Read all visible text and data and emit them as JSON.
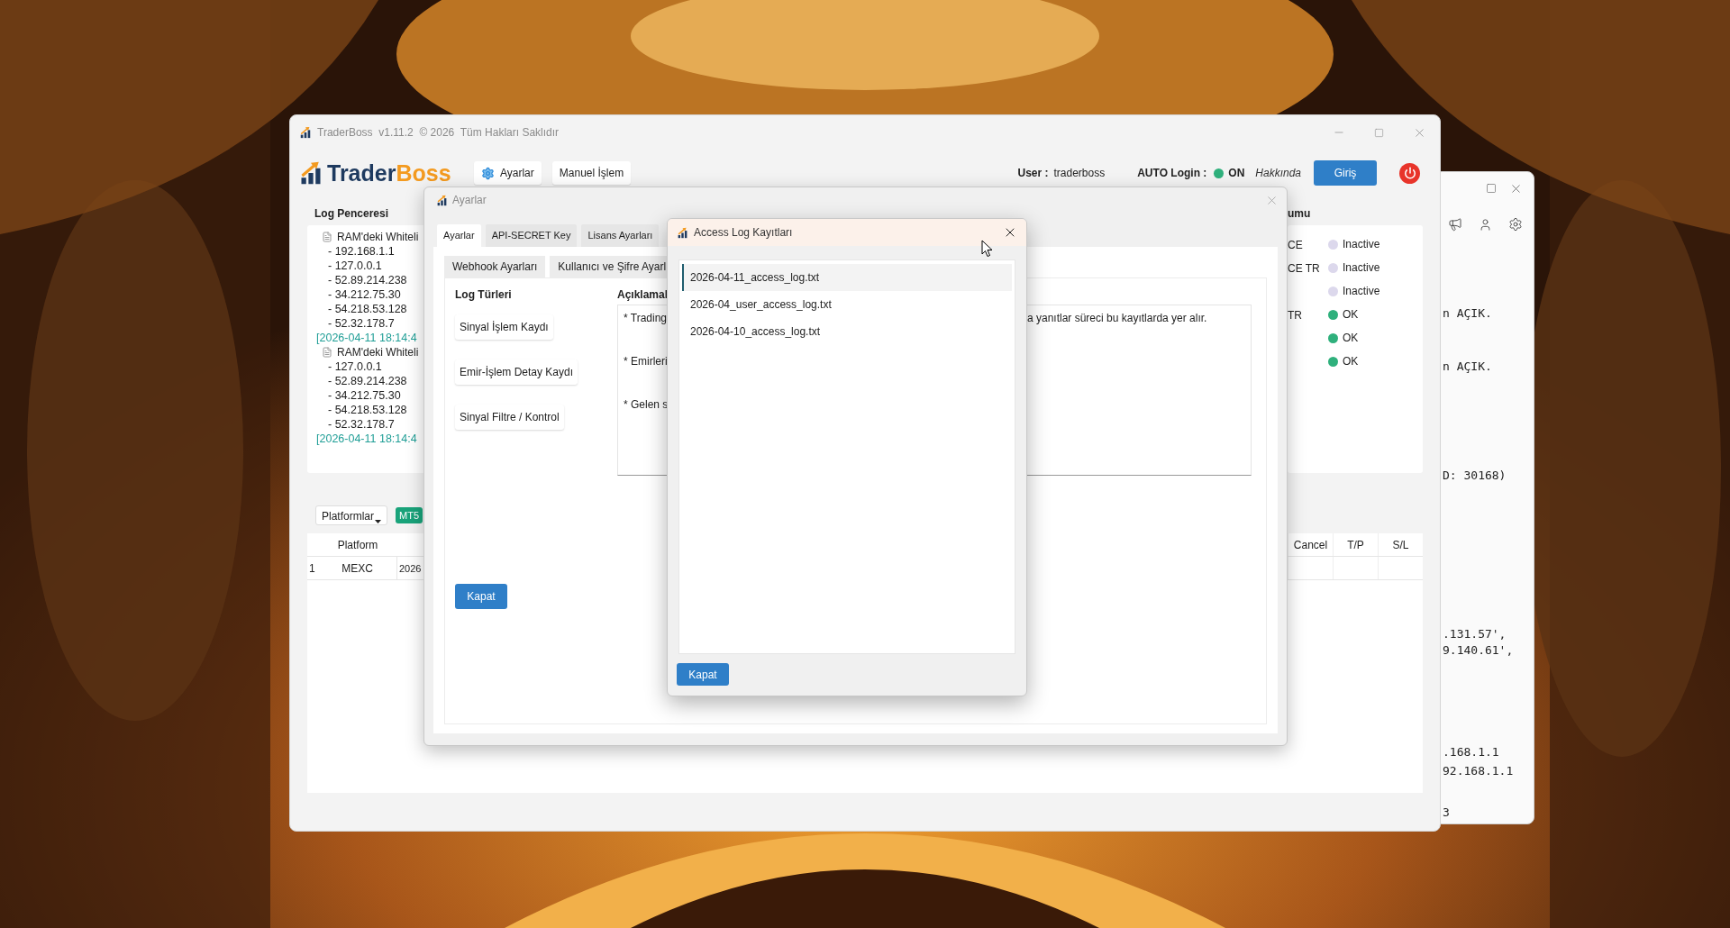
{
  "background_window": {
    "lines": [
      "n AÇIK.",
      "n AÇIK.",
      "D: 30168)",
      ".131.57',",
      "9.140.61',",
      ".168.1.1",
      "92.168.1.1",
      "3"
    ]
  },
  "main_window": {
    "title": "TraderBoss  v1.11.2  © 2026  Tüm Hakları Saklıdır",
    "logo_text": [
      "Trader",
      "Boss"
    ],
    "menu_buttons": [
      {
        "label": "Ayarlar",
        "kind": "settings"
      },
      {
        "label": "Manuel İşlem",
        "kind": "plain"
      }
    ],
    "user_label": "User :",
    "user_name": "traderboss",
    "auto_login": {
      "label": "AUTO Login :",
      "on": true,
      "state_text": "ON"
    },
    "about_link": "Hakkında",
    "login_button": "Giriş",
    "log_panel": {
      "title": "Log Penceresi",
      "entries": [
        {
          "kind": "header",
          "text": "RAM'deki Whiteli"
        },
        {
          "kind": "ip",
          "text": "- 192.168.1.1"
        },
        {
          "kind": "ip",
          "text": "- 127.0.0.1"
        },
        {
          "kind": "ip",
          "text": "- 52.89.214.238"
        },
        {
          "kind": "ip",
          "text": "- 34.212.75.30"
        },
        {
          "kind": "ip",
          "text": "- 54.218.53.128"
        },
        {
          "kind": "ip",
          "text": "- 52.32.178.7"
        },
        {
          "kind": "timestamp",
          "text": "[2026-04-11 18:14:4"
        },
        {
          "kind": "header",
          "text": "RAM'deki Whiteli"
        },
        {
          "kind": "ip",
          "text": "- 127.0.0.1"
        },
        {
          "kind": "ip",
          "text": "- 52.89.214.238"
        },
        {
          "kind": "ip",
          "text": "- 34.212.75.30"
        },
        {
          "kind": "ip",
          "text": "- 54.218.53.128"
        },
        {
          "kind": "ip",
          "text": "- 52.32.178.7"
        },
        {
          "kind": "timestamp",
          "text": "[2026-04-11 18:14:4"
        }
      ]
    },
    "status_panel": {
      "title": "umu",
      "rows": [
        {
          "label": "CE",
          "status": "Inactive",
          "color": "#dcd8ec"
        },
        {
          "label": "CE TR",
          "status": "Inactive",
          "color": "#dcd8ec"
        },
        {
          "status": "Inactive",
          "color": "#dcd8ec"
        },
        {
          "label": "TR",
          "status": "OK",
          "color": "#2fb07c"
        },
        {
          "status": "OK",
          "color": "#2fb07c"
        },
        {
          "status": "OK",
          "color": "#2fb07c"
        }
      ]
    },
    "platform_bar": {
      "dropdown": "Platformlar",
      "badge": "MT5"
    },
    "trades_table": {
      "columns_left": [
        "Platform"
      ],
      "columns_right": [
        "Cancel",
        "T/P",
        "S/L"
      ],
      "rows": [
        {
          "number": "1",
          "platform": "MEXC",
          "column_3": "2026"
        }
      ]
    }
  },
  "settings_dialog": {
    "title": "Ayarlar",
    "tabs": [
      {
        "label": "Ayarlar",
        "selected": true
      },
      {
        "label": "API-SECRET Key",
        "selected": false
      },
      {
        "label": "Lisans Ayarları",
        "selected": false
      }
    ],
    "subtabs": [
      {
        "label": "Webhook Ayarları",
        "selected": false
      },
      {
        "label": "Kullanıcı ve Şifre Ayarl",
        "selected": false
      }
    ],
    "log_types_heading": "Log Türleri",
    "log_type_buttons": [
      "Sinyal İşlem Kaydı",
      "Emir-İşlem Detay Kaydı",
      "Sinyal Filtre / Kontrol"
    ],
    "descriptions_heading": "Açıklamal",
    "descriptions": [
      {
        "text": "* Trading",
        "continuation": "a yanıtlar süreci bu kayıtlarda yer alır."
      },
      {
        "text": "* Emirleri"
      },
      {
        "text": "* Gelen s"
      }
    ],
    "close_button": "Kapat"
  },
  "access_log_dialog": {
    "title": "Access Log Kayıtları",
    "files": [
      {
        "name": "2026-04-11_access_log.txt",
        "selected": true
      },
      {
        "name": "2026-04_user_access_log.txt",
        "selected": false
      },
      {
        "name": "2026-04-10_access_log.txt",
        "selected": false
      }
    ],
    "close_button": "Kapat"
  }
}
